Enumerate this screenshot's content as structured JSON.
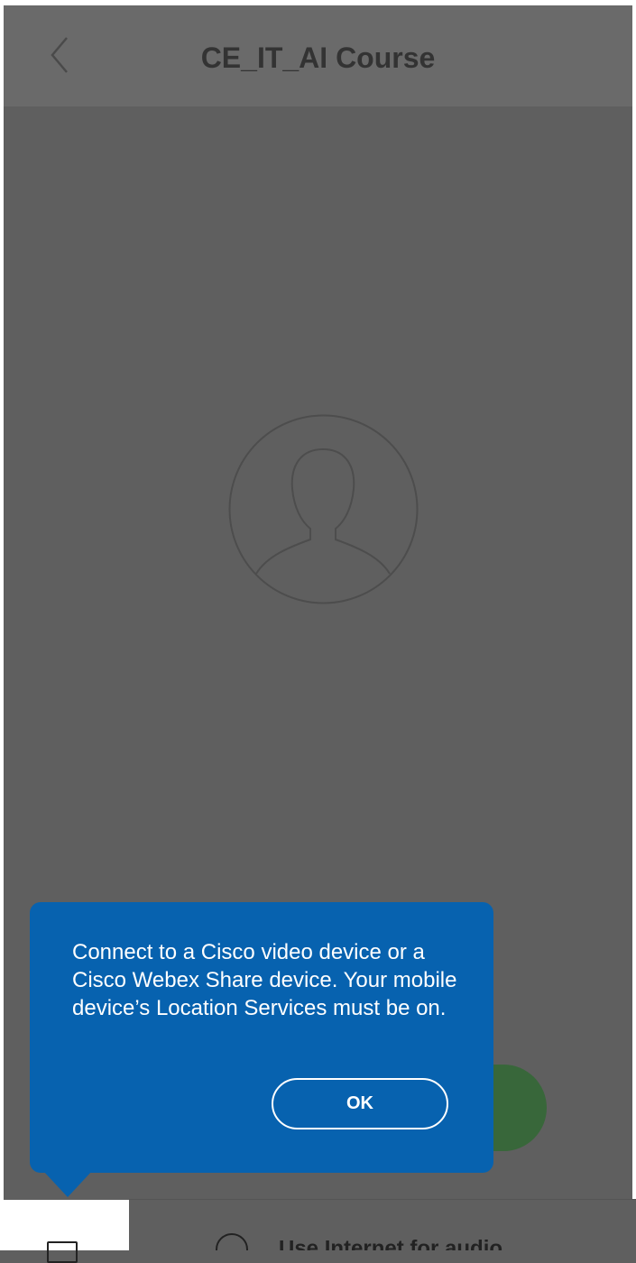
{
  "header": {
    "title": "CE_IT_AI Course",
    "back_icon": "chevron-left-icon"
  },
  "video": {
    "avatar_icon": "person-avatar-icon"
  },
  "tooltip": {
    "message": "Connect to a Cisco video device or a Cisco Webex Share device. Your mobile device’s Location Services must be on.",
    "ok_label": "OK"
  },
  "bottom_bar": {
    "audio_option_label": "Use Internet for audio",
    "share_icon": "screen-share-icon",
    "audio_icon": "audio-icon"
  },
  "colors": {
    "tooltip_bg": "#0762af",
    "join_button": "#38673a",
    "overlay": "#5f5f5f"
  }
}
